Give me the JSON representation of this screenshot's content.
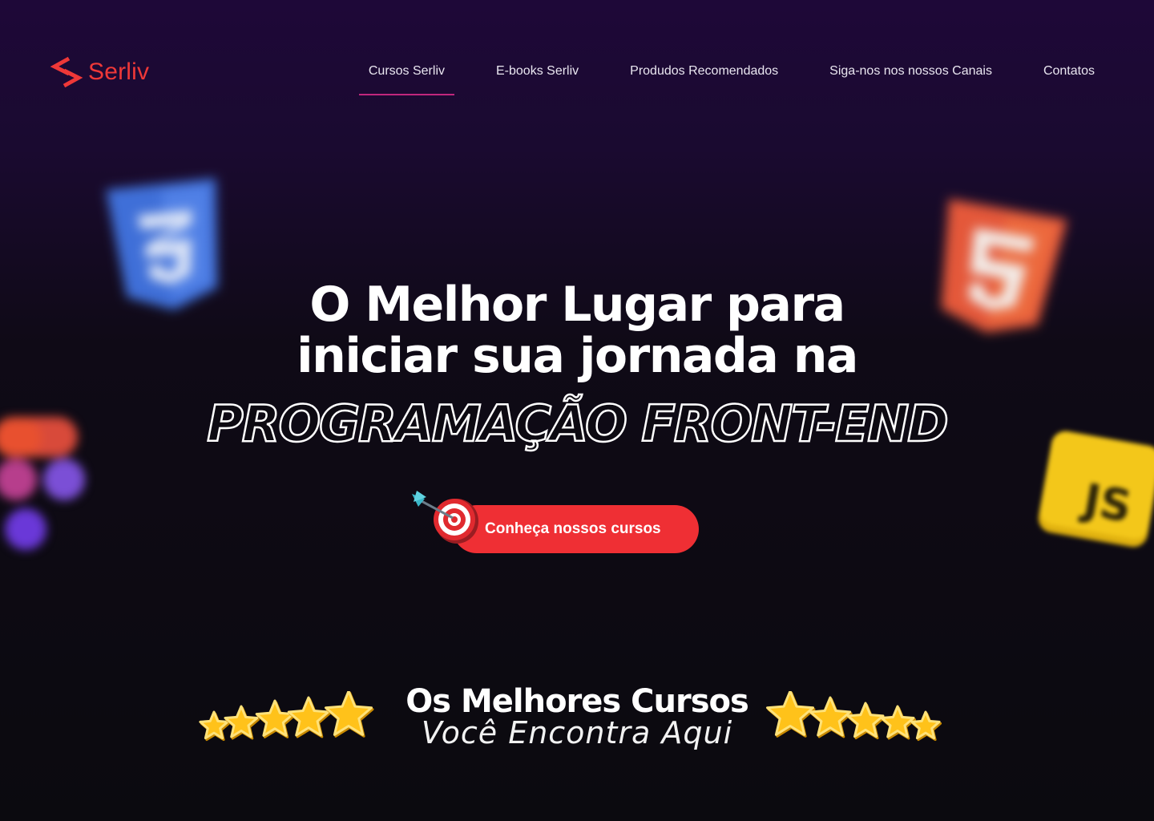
{
  "brand": {
    "name": "Serliv",
    "color": "#ef3838"
  },
  "nav": {
    "items": [
      {
        "label": "Cursos Serliv",
        "active": true
      },
      {
        "label": "E-books Serliv",
        "active": false
      },
      {
        "label": "Produdos Recomendados",
        "active": false
      },
      {
        "label": "Siga-nos nos nossos Canais",
        "active": false
      },
      {
        "label": "Contatos",
        "active": false
      }
    ]
  },
  "hero": {
    "title_line1": "O Melhor Lugar para",
    "title_line2": "iniciar sua jornada na",
    "highlight": "PROGRAMAÇÃO FRONT-END",
    "cta_label": "Conheça nossos cursos"
  },
  "deco": {
    "css_icon": "css3-logo-icon",
    "html_icon": "html5-logo-icon",
    "js_icon": "javascript-logo-icon",
    "figma_icon": "figma-logo-icon",
    "js_text": "JS"
  },
  "section": {
    "title": "Os Melhores Cursos",
    "subtitle": "Você Encontra Aqui"
  },
  "colors": {
    "accent": "#ef2f34",
    "nav_underline": "#c1267d",
    "star": "#ffc21a"
  }
}
